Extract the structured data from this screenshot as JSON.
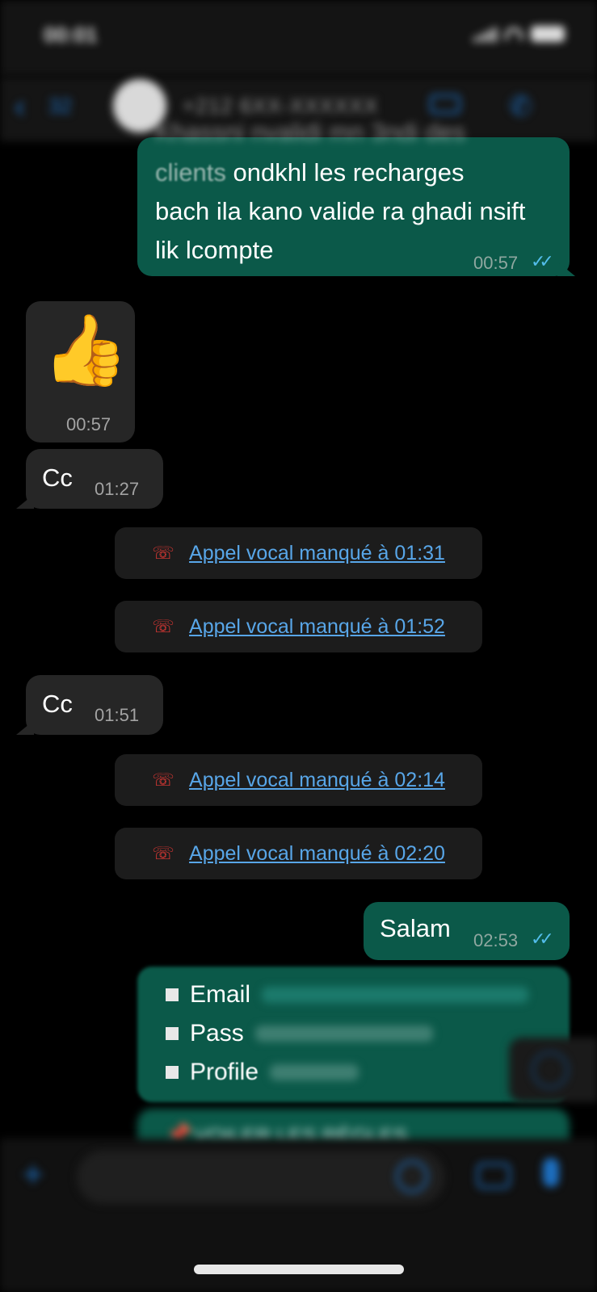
{
  "status": {
    "time": "00:01"
  },
  "header": {
    "back_icon": "chevron-left-icon",
    "back_count": "32",
    "contact_name": "+212 6XX-XXXXXX",
    "video_icon": "video-call-icon",
    "phone_icon": "phone-icon"
  },
  "messages": {
    "m1": {
      "faded_line": "Khassni nvalidi mn 3ndi des",
      "line1": "clients ondkhl les recharges",
      "line2": "bach ila kano valide ra ghadi nsift",
      "line3": "lik lcompte",
      "time": "00:57",
      "ticks": "✓✓"
    },
    "m2": {
      "emoji": "👍",
      "time": "00:57"
    },
    "m3": {
      "text": "Cc",
      "time": "01:27"
    },
    "call1": "Appel vocal manqué à 01:31",
    "call2": "Appel vocal manqué à 01:52",
    "m4": {
      "text": "Cc",
      "time": "01:51"
    },
    "call3": "Appel vocal manqué à 02:14",
    "call4": "Appel vocal manqué à 02:20",
    "m5": {
      "text": "Salam",
      "time": "02:53",
      "ticks": "✓✓"
    },
    "m6": {
      "email_label": "Email",
      "pass_label": "Pass",
      "profile_label": "Profile"
    },
    "m7": {
      "text": "VOILER LES RÈGLES"
    }
  },
  "colors": {
    "outgoing_bubble": "#0b5949",
    "incoming_bubble": "#262626",
    "call_link": "#58a6e8",
    "missed_call_icon": "#e53935",
    "accent": "#1d6fc0"
  }
}
